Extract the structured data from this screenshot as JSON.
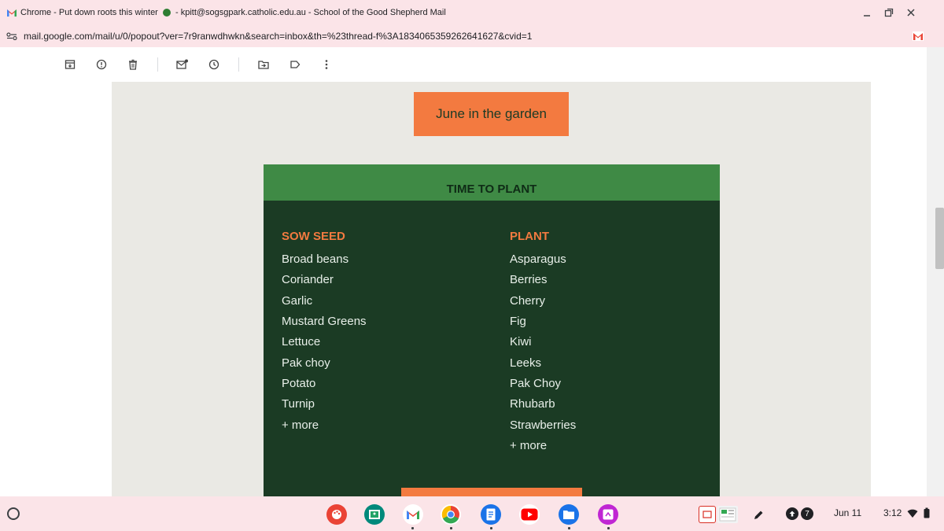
{
  "window": {
    "title_part1": "Chrome - Put down roots this winter",
    "title_part2": "- kpitt@sogsgpark.catholic.edu.au - School of the Good Shepherd Mail",
    "url": "mail.google.com/mail/u/0/popout?ver=7r9ranwdhwkn&search=inbox&th=%23thread-f%3A1834065359262641627&cvid=1"
  },
  "toolbar": {
    "icons": [
      "archive-icon",
      "report-spam-icon",
      "delete-icon",
      "mark-unread-icon",
      "snooze-icon",
      "move-to-icon",
      "label-icon",
      "more-icon"
    ]
  },
  "email": {
    "june_button": "June in the garden",
    "section_title": "TIME TO PLANT",
    "sow_seed": {
      "heading": "SOW SEED",
      "items": [
        "Broad beans",
        "Coriander",
        "Garlic",
        "Mustard Greens",
        "Lettuce",
        "Pak choy",
        "Potato",
        "Turnip",
        "+ more"
      ]
    },
    "plant": {
      "heading": "PLANT",
      "items": [
        "Asparagus",
        "Berries",
        "Cherry",
        "Fig",
        "Kiwi",
        "Leeks",
        "Pak Choy",
        "Rhubarb",
        "Strawberries",
        "+ more"
      ]
    }
  },
  "shelf": {
    "notification_count": "7",
    "date": "Jun 11",
    "time": "3:12"
  },
  "colors": {
    "accent_orange": "#f37a40",
    "header_green": "#3f8a45",
    "body_green": "#1b3b24",
    "chrome_pink": "#fbe4e8"
  }
}
